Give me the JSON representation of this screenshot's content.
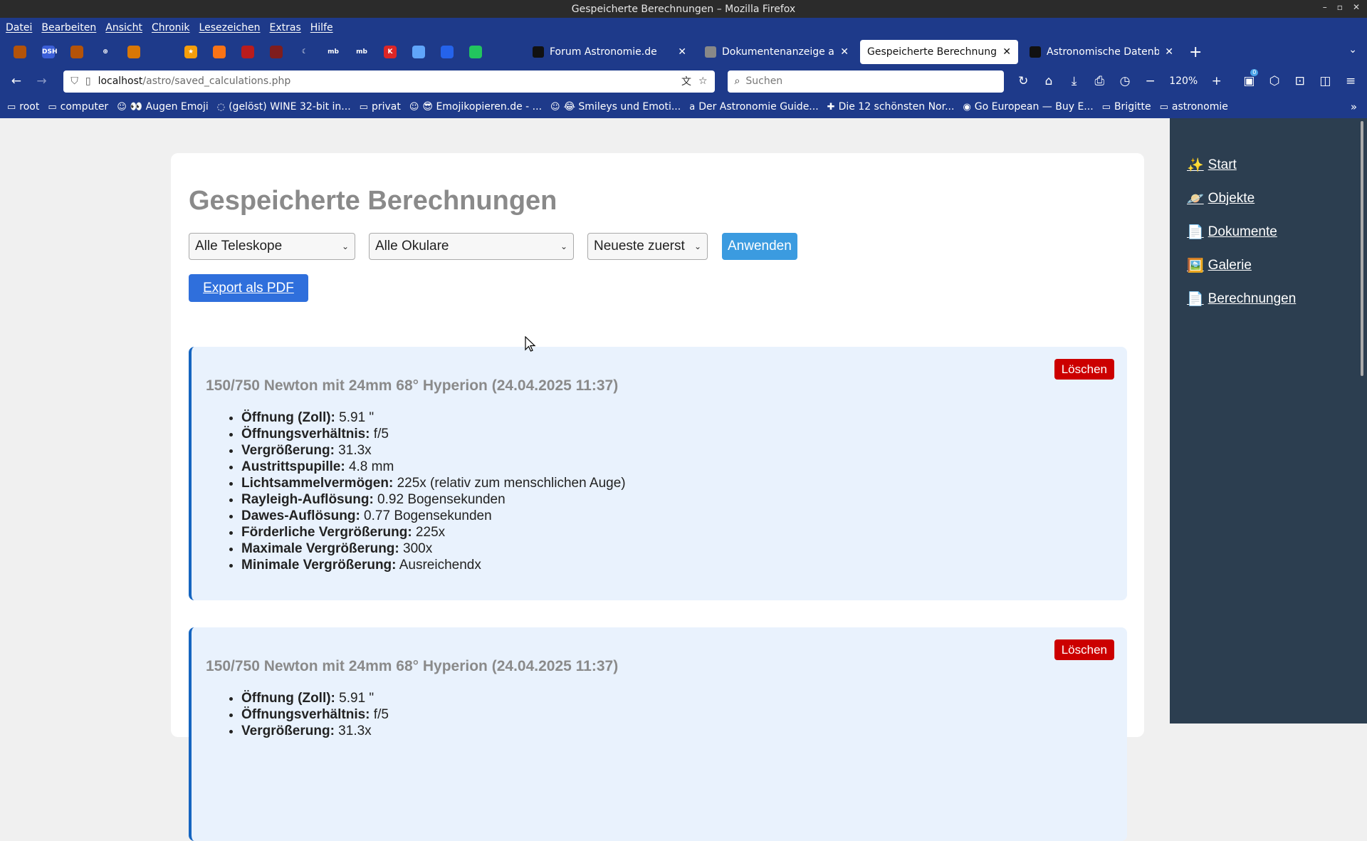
{
  "window": {
    "title": "Gespeicherte Berechnungen – Mozilla Firefox",
    "controls": [
      "minimize-icon",
      "maximize-icon",
      "close-icon"
    ]
  },
  "menubar": {
    "items": [
      "Datei",
      "Bearbeiten",
      "Ansicht",
      "Chronik",
      "Lesezeichen",
      "Extras",
      "Hilfe"
    ]
  },
  "pinned_tabs": [
    {
      "icon": "astro-pyramid-icon",
      "color": "#b45309",
      "text": ""
    },
    {
      "icon": "dsh-icon",
      "color": "#3b5fd9",
      "text": "DSH"
    },
    {
      "icon": "astro-pyramid-icon",
      "color": "#b45309",
      "text": ""
    },
    {
      "icon": "globe-icon",
      "color": "#1e3a8a",
      "text": "⊕"
    },
    {
      "icon": "badge-icon",
      "color": "#d97706",
      "text": ""
    },
    {
      "icon": "telescope-icon",
      "color": "#1e3a8a",
      "text": ""
    },
    {
      "icon": "star-icon",
      "color": "#f59e0b",
      "text": "★"
    },
    {
      "icon": "rss-icon",
      "color": "#f97316",
      "text": ""
    },
    {
      "icon": "film-icon",
      "color": "#b91c1c",
      "text": ""
    },
    {
      "icon": "planet-icon",
      "color": "#7f1d1d",
      "text": ""
    },
    {
      "icon": "moon-icon",
      "color": "#1e3a8a",
      "text": "☾"
    },
    {
      "icon": "mb-icon",
      "color": "#1e3a8a",
      "text": "mb"
    },
    {
      "icon": "mb-icon",
      "color": "#1e3a8a",
      "text": "mb"
    },
    {
      "icon": "k-icon",
      "color": "#dc2626",
      "text": "K"
    },
    {
      "icon": "circle-icon",
      "color": "#60a5fa",
      "text": ""
    },
    {
      "icon": "stellarium-icon",
      "color": "#2563eb",
      "text": ""
    },
    {
      "icon": "whatsapp-icon",
      "color": "#22c55e",
      "text": ""
    },
    {
      "icon": "search-icon",
      "color": "#1e3a8a",
      "text": ""
    }
  ],
  "tabs": [
    {
      "label": "Forum Astronomie.de",
      "fav_color": "#111",
      "width": 236,
      "active": false
    },
    {
      "label": "Dokumentenanzeige anpa",
      "fav_color": "#888",
      "width": 222,
      "active": false
    },
    {
      "label": "Gespeicherte Berechnungen",
      "fav_color": "",
      "width": 222,
      "active": true
    },
    {
      "label": "Astronomische Datenban",
      "fav_color": "#111",
      "width": 222,
      "active": false
    }
  ],
  "urlbar": {
    "host": "localhost",
    "path": "/astro/saved_calculations.php"
  },
  "search": {
    "placeholder": "Suchen"
  },
  "zoom": "120%",
  "ext_badge": "0",
  "bookmarks": [
    {
      "icon": "folder-icon",
      "label": "root"
    },
    {
      "icon": "folder-icon",
      "label": "computer"
    },
    {
      "icon": "emoji-icon",
      "label": "👀 Augen Emoji"
    },
    {
      "icon": "wine-icon",
      "label": "(gelöst) WINE 32-bit in..."
    },
    {
      "icon": "folder-icon",
      "label": "privat"
    },
    {
      "icon": "emoji-icon",
      "label": "😎 Emojikopieren.de - ..."
    },
    {
      "icon": "emoji-icon",
      "label": "😂 Smileys und Emoti..."
    },
    {
      "icon": "amazon-icon",
      "label": "Der Astronomie Guide..."
    },
    {
      "icon": "flag-icon",
      "label": "Die 12 schönsten Nor..."
    },
    {
      "icon": "eu-icon",
      "label": "Go European — Buy E..."
    },
    {
      "icon": "folder-icon",
      "label": "Brigitte"
    },
    {
      "icon": "folder-icon",
      "label": "astronomie"
    }
  ],
  "page": {
    "heading": "Gespeicherte Berechnungen",
    "filters": {
      "telescope": "Alle Teleskope",
      "eyepiece": "Alle Okulare",
      "sort": "Neueste zuerst",
      "apply": "Anwenden"
    },
    "export": "Export als PDF",
    "delete_label": "Löschen",
    "calculations": [
      {
        "title": "150/750 Newton mit 24mm 68° Hyperion (24.04.2025 11:37)",
        "rows": [
          {
            "k": "Öffnung (Zoll):",
            "v": " 5.91 \""
          },
          {
            "k": "Öffnungsverhältnis:",
            "v": " f/5"
          },
          {
            "k": "Vergrößerung:",
            "v": " 31.3x"
          },
          {
            "k": "Austrittspupille:",
            "v": " 4.8 mm"
          },
          {
            "k": "Lichtsammelvermögen:",
            "v": " 225x (relativ zum menschlichen Auge)"
          },
          {
            "k": "Rayleigh-Auflösung:",
            "v": " 0.92 Bogensekunden"
          },
          {
            "k": "Dawes-Auflösung:",
            "v": " 0.77 Bogensekunden"
          },
          {
            "k": "Förderliche Vergrößerung:",
            "v": " 225x"
          },
          {
            "k": "Maximale Vergrößerung:",
            "v": " 300x"
          },
          {
            "k": "Minimale Vergrößerung:",
            "v": " Ausreichendx"
          }
        ]
      },
      {
        "title": "150/750 Newton mit 24mm 68° Hyperion (24.04.2025 11:37)",
        "rows": [
          {
            "k": "Öffnung (Zoll):",
            "v": " 5.91 \""
          },
          {
            "k": "Öffnungsverhältnis:",
            "v": " f/5"
          },
          {
            "k": "Vergrößerung:",
            "v": " 31.3x"
          }
        ]
      }
    ]
  },
  "sidebar": {
    "links": [
      {
        "emoji": "✨",
        "label": "Start"
      },
      {
        "emoji": "🪐",
        "label": "Objekte"
      },
      {
        "emoji": "📄",
        "label": "Dokumente"
      },
      {
        "emoji": "🖼️",
        "label": "Galerie"
      },
      {
        "emoji": "📄",
        "label": "Berechnungen"
      }
    ]
  }
}
